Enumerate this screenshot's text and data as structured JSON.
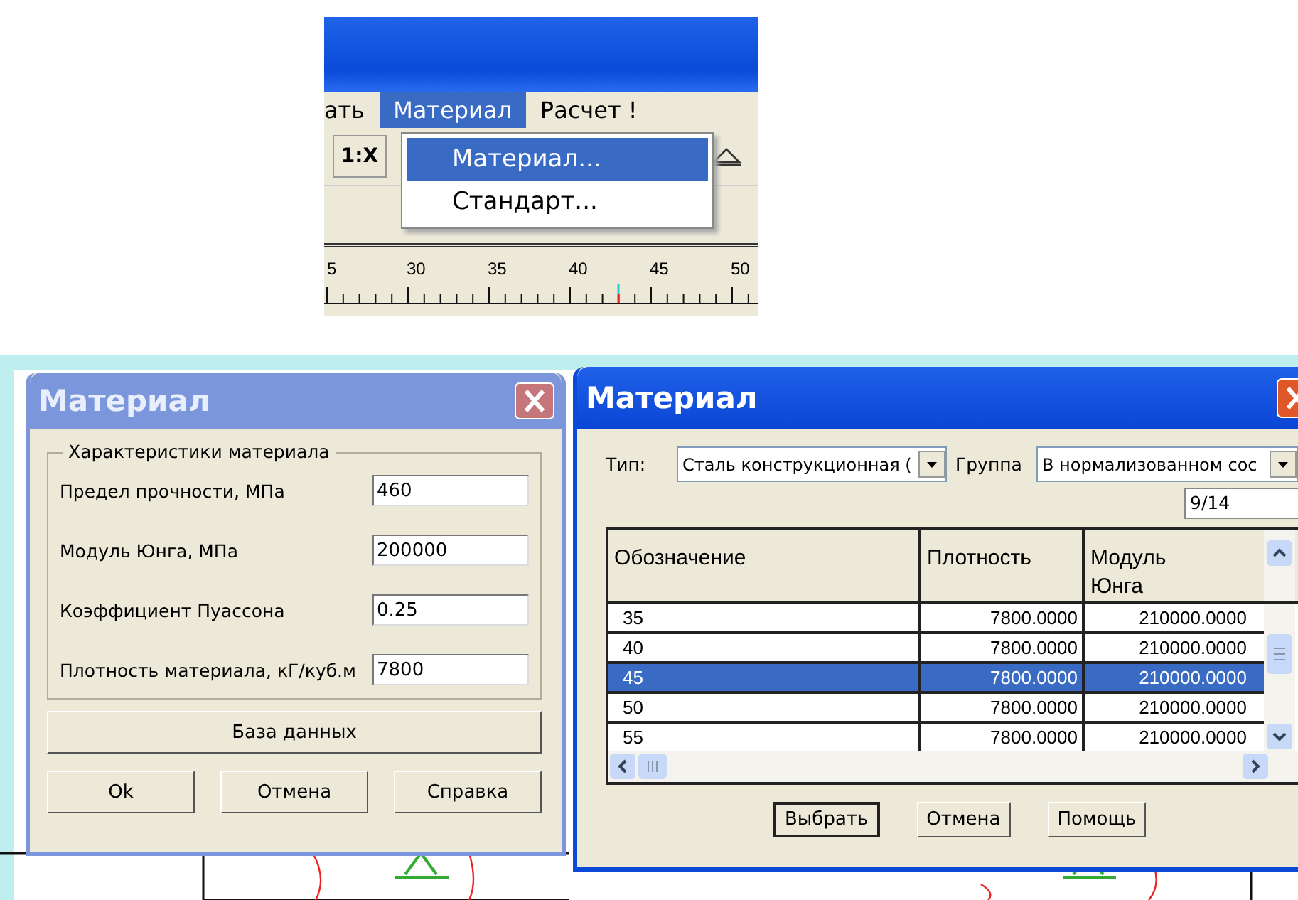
{
  "app_fragment": {
    "menu": [
      {
        "label": "ать",
        "selected": false
      },
      {
        "label": "Материал",
        "selected": true
      },
      {
        "label": "Расчет !",
        "selected": false
      }
    ],
    "toolbar_button": "1:X",
    "dropdown": [
      {
        "label": "Материал...",
        "selected": true
      },
      {
        "label": "Стандарт...",
        "selected": false
      }
    ],
    "ruler_labels": [
      "5",
      "30",
      "35",
      "40",
      "45",
      "50"
    ]
  },
  "material_dialog": {
    "title": "Материал",
    "group_title": "Характеристики материала",
    "fields": [
      {
        "label": "Предел прочности, МПа",
        "value": "460"
      },
      {
        "label": "Модуль Юнга, МПа",
        "value": "200000"
      },
      {
        "label": "Коэффициент Пуассона",
        "value": "0.25"
      },
      {
        "label": "Плотность материала, кГ/куб.м",
        "value": "7800"
      }
    ],
    "database_button": "База данных",
    "buttons": [
      "Ok",
      "Отмена",
      "Справка"
    ]
  },
  "database_dialog": {
    "title": "Материал",
    "type_label": "Тип:",
    "type_value": "Сталь конструкционная (",
    "group_label": "Группа",
    "group_value": "В нормализованном сос",
    "counter": "9/14",
    "table": {
      "columns": [
        "Обозначение",
        "Плотность",
        "Модуль Юнга"
      ],
      "rows": [
        {
          "cells": [
            "35",
            "7800.0000",
            "210000.0000"
          ],
          "selected": false
        },
        {
          "cells": [
            "40",
            "7800.0000",
            "210000.0000"
          ],
          "selected": false
        },
        {
          "cells": [
            "45",
            "7800.0000",
            "210000.0000"
          ],
          "selected": true
        },
        {
          "cells": [
            "50",
            "7800.0000",
            "210000.0000"
          ],
          "selected": false
        },
        {
          "cells": [
            "55",
            "7800.0000",
            "210000.0000"
          ],
          "selected": false
        }
      ]
    },
    "buttons": [
      {
        "label": "Выбрать",
        "default": true
      },
      {
        "label": "Отмена",
        "default": false
      },
      {
        "label": "Помощь",
        "default": false
      }
    ]
  }
}
